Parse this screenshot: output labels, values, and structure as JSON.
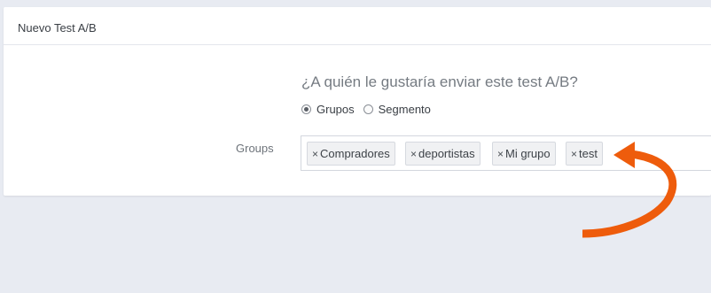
{
  "card": {
    "title": "Nuevo Test A/B"
  },
  "form": {
    "question": "¿A quién le gustaría enviar este test A/B?",
    "radio_options": [
      {
        "label": "Grupos",
        "checked": true
      },
      {
        "label": "Segmento",
        "checked": false
      }
    ],
    "groups_label": "Groups",
    "tags": [
      {
        "remove": "×",
        "label": "Compradores"
      },
      {
        "remove": "×",
        "label": "deportistas"
      },
      {
        "remove": "×",
        "label": "Mi grupo"
      },
      {
        "remove": "×",
        "label": "test"
      }
    ]
  },
  "colors": {
    "page_background": "#e8ebf2",
    "card_background": "#ffffff",
    "annotation_arrow": "#ee5c0c"
  }
}
